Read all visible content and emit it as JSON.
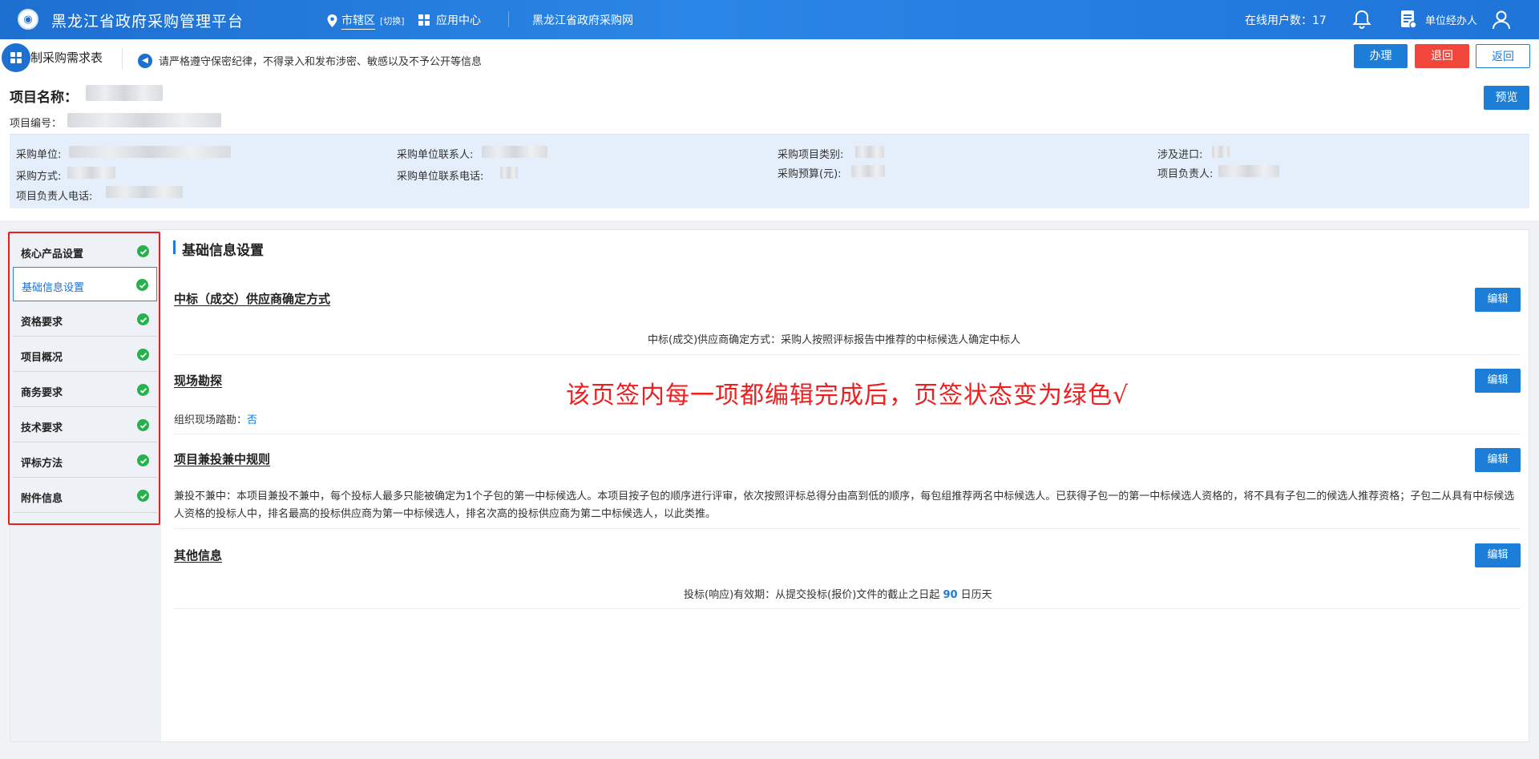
{
  "topbar": {
    "title": "黑龙江省政府采购管理平台",
    "region": "市辖区",
    "switch_label": "[切换]",
    "app_center": "应用中心",
    "portal_link": "黑龙江省政府采购网",
    "online_users": "在线用户数：17",
    "user_role": "单位经办人"
  },
  "header": {
    "page_title": "制采购需求表",
    "notice": "请严格遵守保密纪律，不得录入和发布涉密、敏感以及不予公开等信息",
    "buttons": {
      "handle": "办理",
      "back": "退回",
      "return": "返回",
      "preview": "预览"
    }
  },
  "project": {
    "name_label": "项目名称：",
    "number_label": "项目编号：",
    "fields": {
      "purchase_unit": "采购单位:",
      "unit_contact": "采购单位联系人:",
      "project_category": "采购项目类别:",
      "import": "涉及进口:",
      "purchase_method": "采购方式:",
      "unit_phone": "采购单位联系电话:",
      "budget": "采购预算(元):",
      "leader": "项目负责人:",
      "leader_phone": "项目负责人电话:"
    }
  },
  "sidebar": {
    "items": [
      {
        "label": "核心产品设置",
        "done": true
      },
      {
        "label": "基础信息设置",
        "done": true,
        "active": true
      },
      {
        "label": "资格要求",
        "done": true
      },
      {
        "label": "项目概况",
        "done": true
      },
      {
        "label": "商务要求",
        "done": true
      },
      {
        "label": "技术要求",
        "done": true
      },
      {
        "label": "评标方法",
        "done": true
      },
      {
        "label": "附件信息",
        "done": true
      }
    ]
  },
  "main": {
    "title": "基础信息设置",
    "edit_label": "编辑",
    "sections": {
      "winner": {
        "title": "中标（成交）供应商确定方式",
        "text": "中标(成交)供应商确定方式：采购人按照评标报告中推荐的中标候选人确定中标人"
      },
      "site": {
        "title": "现场勘探",
        "label": "组织现场踏勘：",
        "value": "否"
      },
      "rules": {
        "title": "项目兼投兼中规则",
        "text": "兼投不兼中：本项目兼投不兼中，每个投标人最多只能被确定为1个子包的第一中标候选人。本项目按子包的顺序进行评审，依次按照评标总得分由高到低的顺序，每包组推荐两名中标候选人。已获得子包一的第一中标候选人资格的，将不具有子包二的候选人推荐资格；子包二从具有中标候选人资格的投标人中，排名最高的投标供应商为第一中标候选人，排名次高的投标供应商为第二中标候选人，以此类推。"
      },
      "other": {
        "title": "其他信息",
        "text_before": "投标(响应)有效期：从提交投标(报价)文件的截止之日起",
        "days": "90",
        "text_after": "日历天"
      }
    }
  },
  "annotation": "该页签内每一项都编辑完成后，页签状态变为绿色√"
}
